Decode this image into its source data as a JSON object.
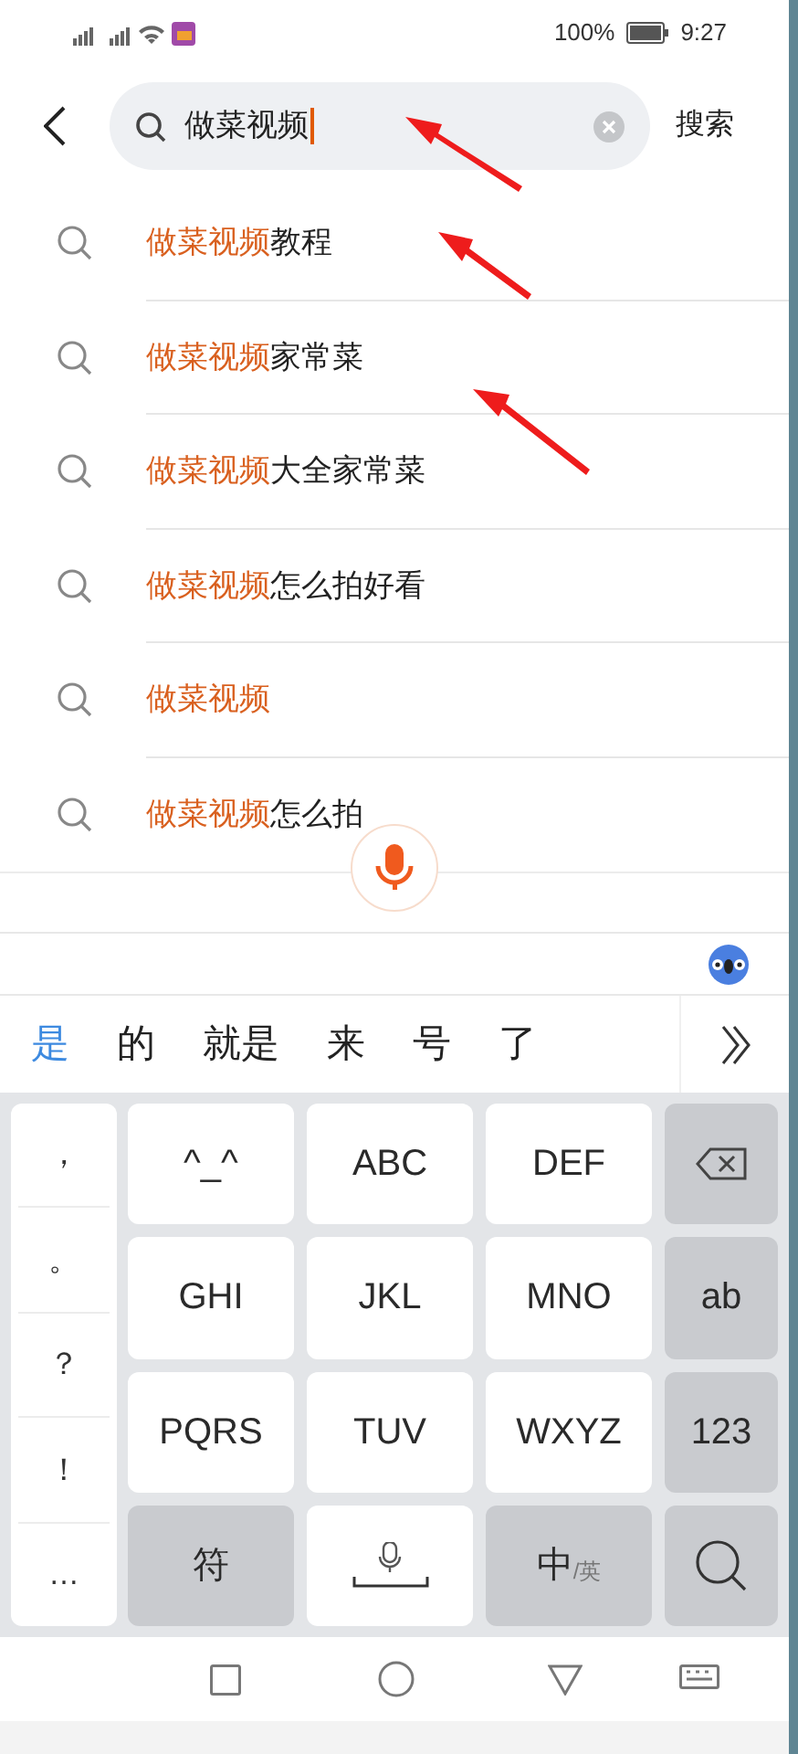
{
  "status_bar": {
    "battery_text": "100%",
    "time": "9:27"
  },
  "search": {
    "value": "做菜视频",
    "button": "搜索"
  },
  "suggestions": [
    {
      "match": "做菜视频",
      "rest": "教程"
    },
    {
      "match": "做菜视频",
      "rest": "家常菜"
    },
    {
      "match": "做菜视频",
      "rest": "大全家常菜"
    },
    {
      "match": "做菜视频",
      "rest": "怎么拍好看"
    },
    {
      "match": "做菜视频"
    },
    {
      "match": "做菜视频",
      "rest": "怎么拍"
    }
  ],
  "candidates": [
    {
      "text": "是",
      "selected": true
    },
    {
      "text": "的",
      "selected": false
    },
    {
      "text": "就是",
      "selected": false
    },
    {
      "text": "来",
      "selected": false
    },
    {
      "text": "号",
      "selected": false
    },
    {
      "text": "了",
      "selected": false
    }
  ],
  "symbols": [
    "，",
    "。",
    "？",
    "！",
    "…"
  ],
  "keys": [
    {
      "kind": "text",
      "label": "^_^",
      "dark": false
    },
    {
      "kind": "text",
      "label": "ABC",
      "dark": false
    },
    {
      "kind": "text",
      "label": "DEF",
      "dark": false
    },
    {
      "kind": "backspace",
      "dark": true
    },
    {
      "kind": "text",
      "label": "GHI",
      "dark": false
    },
    {
      "kind": "text",
      "label": "JKL",
      "dark": false
    },
    {
      "kind": "text",
      "label": "MNO",
      "dark": false
    },
    {
      "kind": "text",
      "label": "ab",
      "dark": true
    },
    {
      "kind": "text",
      "label": "PQRS",
      "dark": false
    },
    {
      "kind": "text",
      "label": "TUV",
      "dark": false
    },
    {
      "kind": "text",
      "label": "WXYZ",
      "dark": false
    },
    {
      "kind": "text",
      "label": "123",
      "dark": true
    },
    {
      "kind": "text",
      "label": "符",
      "dark": true
    },
    {
      "kind": "space",
      "dark": false
    },
    {
      "kind": "lang",
      "label": "中",
      "sub": "/英",
      "dark": true
    },
    {
      "kind": "search",
      "dark": true
    }
  ]
}
